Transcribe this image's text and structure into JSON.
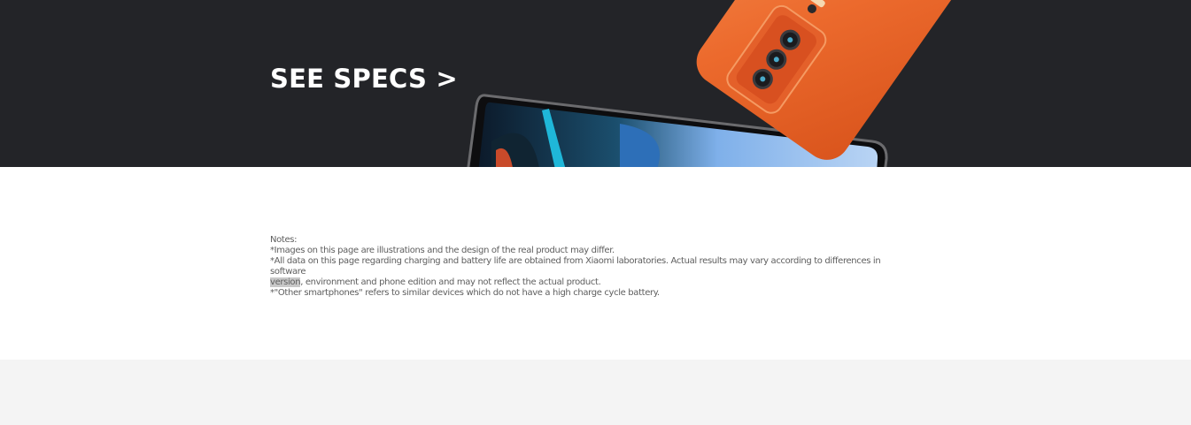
{
  "hero": {
    "cta_label": "SEE SPECS >",
    "background_color": "#232428",
    "phone_back_color": "#ee6b2e"
  },
  "notes": {
    "heading": "Notes:",
    "line_1": "*Images on this page are illustrations and the design of the real product may differ.",
    "line_2": "*All data on this page regarding charging and battery life are obtained from Xiaomi laboratories. Actual results may vary according to differences in software",
    "line_3_highlighted": "version",
    "line_3_rest": ", environment and phone edition and may not reflect the actual product.",
    "line_4": "*\"Other smartphones\" refers to similar devices which do not have a high charge cycle battery."
  }
}
